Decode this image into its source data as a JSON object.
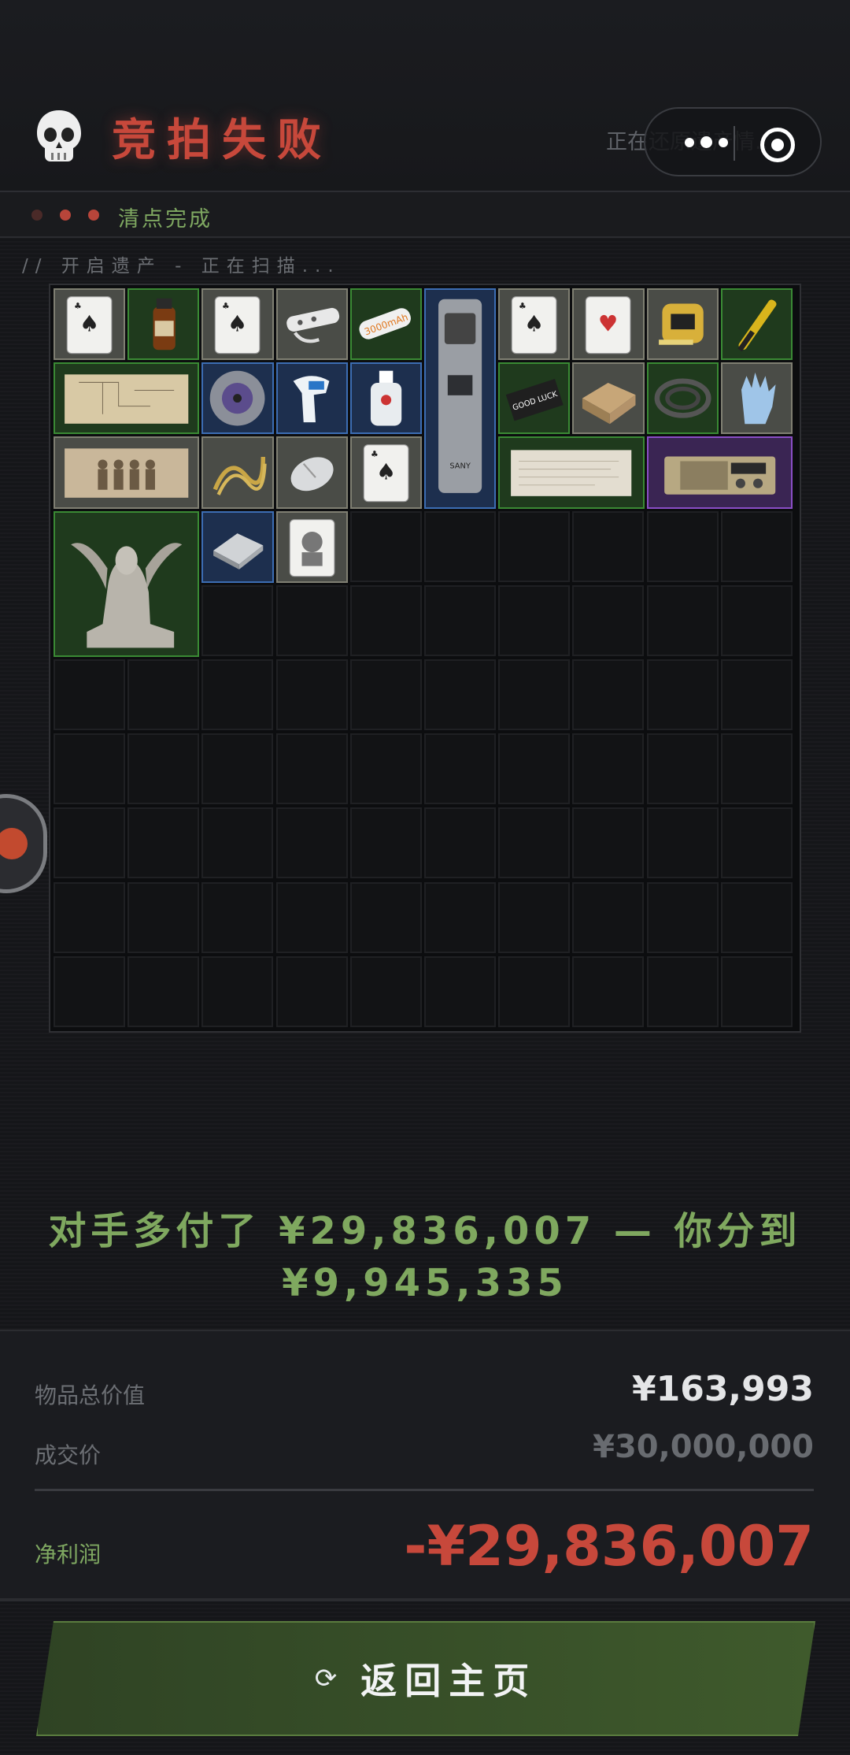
{
  "header": {
    "title": "竞拍失败",
    "restore_status": "正在还原遗产情...",
    "colors": {
      "title": "#c7483b",
      "accent_green": "#7fa861"
    }
  },
  "status_bar": {
    "text": "清点完成"
  },
  "scan": {
    "text": "// 开启遗产 - 正在扫描..."
  },
  "inventory": {
    "columns": 10,
    "rows": 10,
    "items": [
      {
        "name": "playing-card",
        "rarity": "gray"
      },
      {
        "name": "medicine-bottle",
        "rarity": "green"
      },
      {
        "name": "playing-card",
        "rarity": "gray"
      },
      {
        "name": "power-strip",
        "rarity": "gray"
      },
      {
        "name": "battery",
        "rarity": "green",
        "text": "3000mAh"
      },
      {
        "name": "power-bank",
        "rarity": "blue",
        "text": "SANY"
      },
      {
        "name": "playing-card",
        "rarity": "gray"
      },
      {
        "name": "playing-card-hearts",
        "rarity": "gray"
      },
      {
        "name": "tape-measure",
        "rarity": "gray"
      },
      {
        "name": "test-pen",
        "rarity": "green"
      },
      {
        "name": "blueprint-map",
        "rarity": "green"
      },
      {
        "name": "cd-disc",
        "rarity": "blue"
      },
      {
        "name": "thermometer-gun",
        "rarity": "blue"
      },
      {
        "name": "medical-bottle",
        "rarity": "blue"
      },
      {
        "name": "card-box",
        "rarity": "green",
        "text": "GOOD LUCK"
      },
      {
        "name": "small-box",
        "rarity": "gray"
      },
      {
        "name": "hose-coil",
        "rarity": "green"
      },
      {
        "name": "gloves",
        "rarity": "gray"
      },
      {
        "name": "old-photo",
        "rarity": "gray"
      },
      {
        "name": "rope",
        "rarity": "gray"
      },
      {
        "name": "mouse",
        "rarity": "gray"
      },
      {
        "name": "playing-card",
        "rarity": "gray"
      },
      {
        "name": "old-document",
        "rarity": "green"
      },
      {
        "name": "radio",
        "rarity": "purple"
      },
      {
        "name": "sphinx-statue",
        "rarity": "green"
      },
      {
        "name": "cpu-chip",
        "rarity": "blue"
      },
      {
        "name": "portrait-card",
        "rarity": "gray"
      }
    ]
  },
  "message": {
    "line1": "对手多付了 ¥29,836,007 — 你分到",
    "line2": "¥9,945,335"
  },
  "summary": {
    "total_label": "物品总价值",
    "total_value": "¥163,993",
    "deal_label": "成交价",
    "deal_value": "¥30,000,000",
    "profit_label": "净利润",
    "profit_value": "-¥29,836,007",
    "colors": {
      "profit": "#c7483b",
      "profit_label": "#7fa861"
    }
  },
  "return_button": {
    "label": "返回主页",
    "icon": "refresh-icon"
  }
}
